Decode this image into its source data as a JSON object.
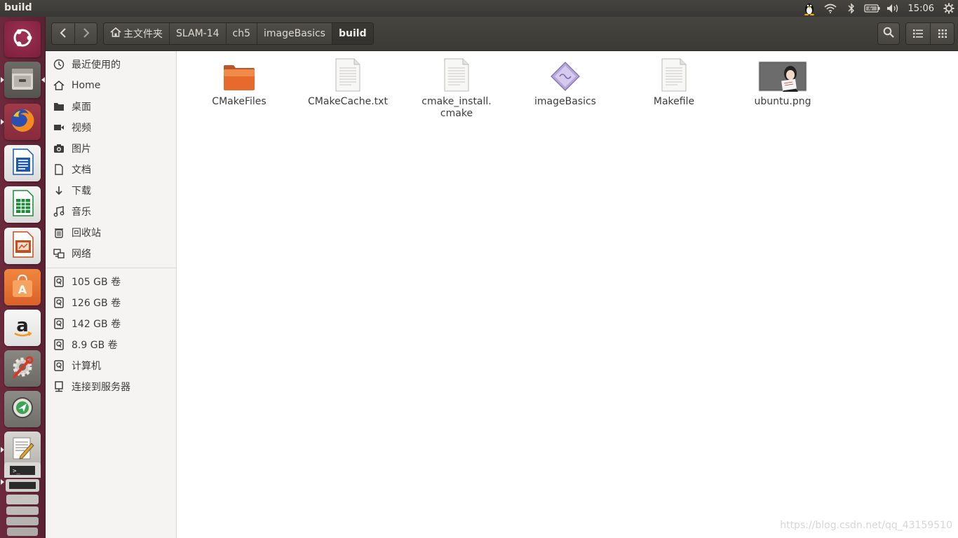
{
  "window": {
    "title": "build"
  },
  "tray": {
    "time": "15:06"
  },
  "launcher": {
    "items": [
      {
        "name": "ubuntu-dash",
        "icon": "ubuntu-logo-icon"
      },
      {
        "name": "files",
        "icon": "file-cabinet-icon"
      },
      {
        "name": "firefox",
        "icon": "firefox-icon"
      },
      {
        "name": "writer",
        "icon": "libreoffice-writer-icon"
      },
      {
        "name": "calc",
        "icon": "libreoffice-calc-icon"
      },
      {
        "name": "impress",
        "icon": "libreoffice-impress-icon"
      },
      {
        "name": "software-center",
        "icon": "software-center-icon"
      },
      {
        "name": "amazon",
        "icon": "amazon-icon"
      },
      {
        "name": "system-settings",
        "icon": "settings-gear-icon"
      },
      {
        "name": "app",
        "icon": "green-arrow-icon"
      },
      {
        "name": "text-editor",
        "icon": "text-editor-icon"
      }
    ]
  },
  "breadcrumbs": [
    {
      "label": "主文件夹",
      "home": true
    },
    {
      "label": "SLAM-14"
    },
    {
      "label": "ch5"
    },
    {
      "label": "imageBasics"
    },
    {
      "label": "build",
      "active": true
    }
  ],
  "sidebar": {
    "places": [
      {
        "label": "最近使用的",
        "icon": "clock-icon"
      },
      {
        "label": "Home",
        "icon": "home-icon"
      },
      {
        "label": "桌面",
        "icon": "folder-icon"
      },
      {
        "label": "视频",
        "icon": "video-icon"
      },
      {
        "label": "图片",
        "icon": "camera-icon"
      },
      {
        "label": "文档",
        "icon": "document-icon"
      },
      {
        "label": "下载",
        "icon": "download-icon"
      },
      {
        "label": "音乐",
        "icon": "music-icon"
      },
      {
        "label": "回收站",
        "icon": "trash-icon"
      },
      {
        "label": "网络",
        "icon": "network-icon"
      }
    ],
    "devices": [
      {
        "label": "105 GB 卷",
        "icon": "drive-icon"
      },
      {
        "label": "126 GB 卷",
        "icon": "drive-icon"
      },
      {
        "label": "142 GB 卷",
        "icon": "drive-icon"
      },
      {
        "label": "8.9 GB 卷",
        "icon": "drive-icon"
      },
      {
        "label": "计算机",
        "icon": "drive-icon"
      },
      {
        "label": "连接到服务器",
        "icon": "server-icon"
      }
    ]
  },
  "files": [
    {
      "name": "CMakeFiles",
      "type": "folder",
      "icon": "folder-icon"
    },
    {
      "name": "CMakeCache.txt",
      "type": "text",
      "icon": "text-file-icon"
    },
    {
      "name": "cmake_install.\ncmake",
      "type": "text",
      "icon": "text-file-icon"
    },
    {
      "name": "imageBasics",
      "type": "executable",
      "icon": "executable-icon"
    },
    {
      "name": "Makefile",
      "type": "text",
      "icon": "text-file-icon"
    },
    {
      "name": "ubuntu.png",
      "type": "image",
      "icon": "image-thumbnail-icon"
    }
  ],
  "watermark": "https://blog.csdn.net/qq_43159510"
}
